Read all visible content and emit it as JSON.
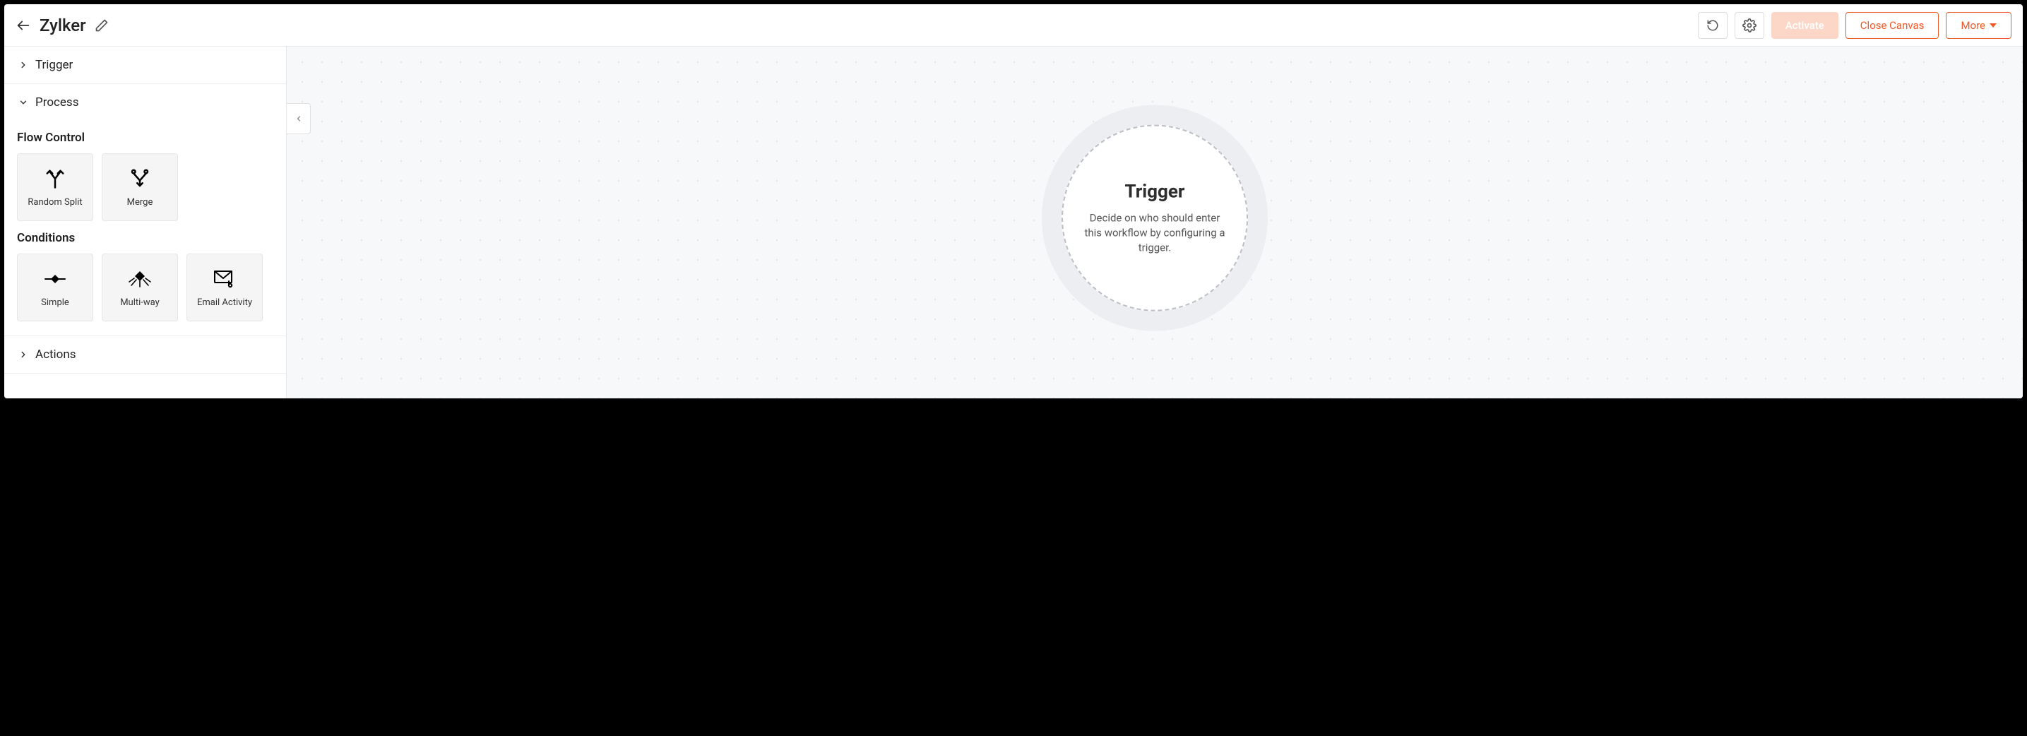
{
  "header": {
    "title": "Zylker",
    "activate_label": "Activate",
    "close_label": "Close Canvas",
    "more_label": "More"
  },
  "sidebar": {
    "trigger_label": "Trigger",
    "process_label": "Process",
    "actions_label": "Actions",
    "flow_control_heading": "Flow Control",
    "conditions_heading": "Conditions",
    "flow_control": {
      "random_split": "Random Split",
      "merge": "Merge"
    },
    "conditions": {
      "simple": "Simple",
      "multi_way": "Multi-way",
      "email_activity": "Email Activity"
    }
  },
  "canvas": {
    "trigger_title": "Trigger",
    "trigger_description": "Decide on who should enter this workflow by configuring a trigger."
  }
}
